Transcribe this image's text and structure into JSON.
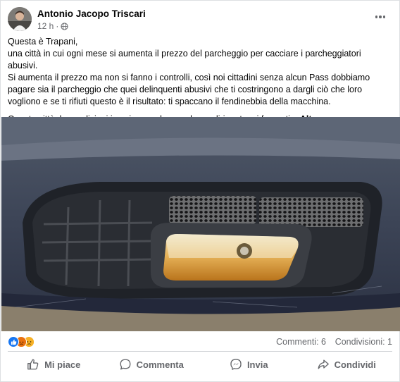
{
  "post": {
    "author": "Antonio Jacopo Triscari",
    "time": "12 h",
    "separator": "·",
    "paragraphs": [
      "Questa è Trapani,",
      "una città in cui ogni mese si aumenta il prezzo del parcheggio per cacciare i parcheggiatori abusivi.",
      "Si aumenta il prezzo ma non si fanno i controlli, così noi cittadini senza alcun Pass dobbiamo pagare sia il parcheggio che quei delinquenti abusivi che ti costringono a dargli ciò che loro vogliono e se ti rifiuti questo è il risultato: ti spaccano il fendinebbia della macchina."
    ],
    "continuation": "Questa città, le condizioni in cui versa, la sua classe dirigente mi fa penti...",
    "see_more": "Altro..."
  },
  "reactions": {
    "icons": [
      "like-icon",
      "angry-icon",
      "sad-icon"
    ],
    "comments": "Commenti: 6",
    "shares": "Condivisioni: 1"
  },
  "actions": {
    "like": "Mi piace",
    "comment": "Commenta",
    "send": "Invia",
    "share": "Condividi"
  },
  "colors": {
    "accent": "#1877f2",
    "secondary_text": "#65676b",
    "angry": "#e9710f",
    "sad": "#f7b125"
  }
}
